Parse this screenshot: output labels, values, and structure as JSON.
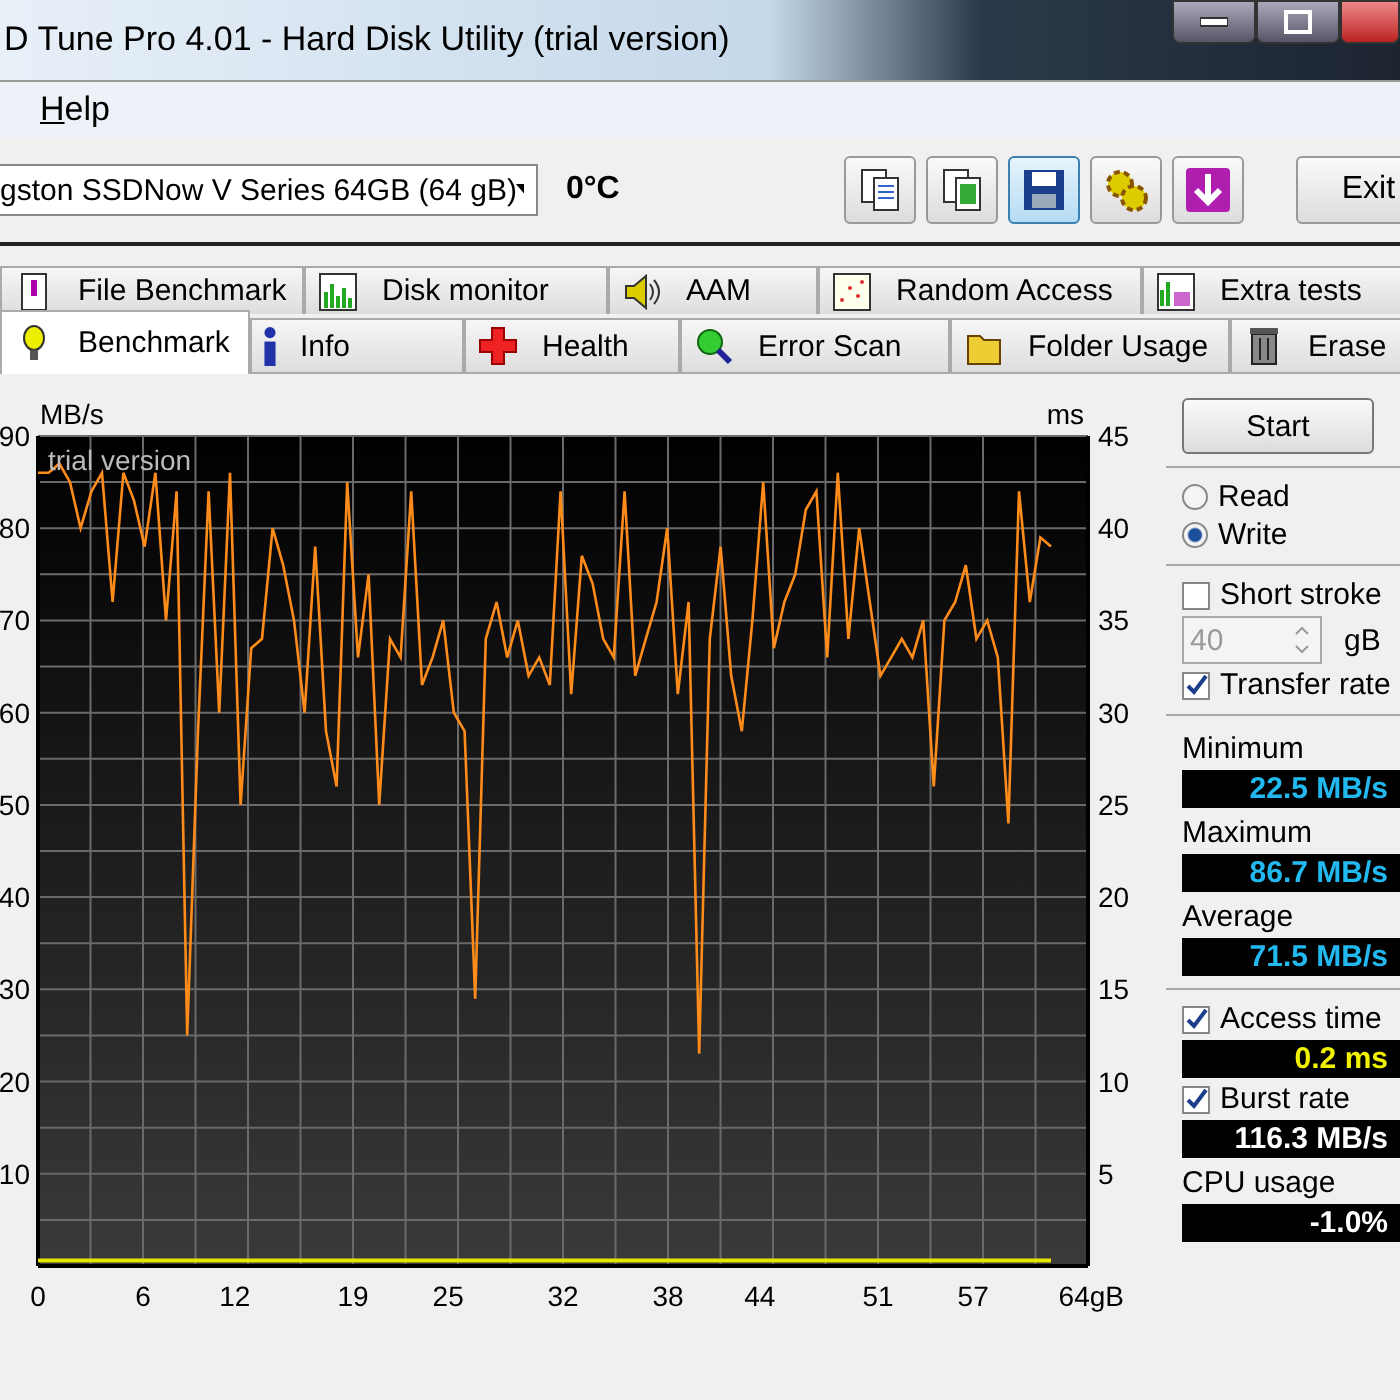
{
  "window": {
    "title": "D Tune Pro 4.01 - Hard Disk Utility (trial version)"
  },
  "menu": [
    {
      "label": "Help"
    }
  ],
  "toolbar": {
    "drive": "gston SSDNow V Series 64GB (64 gB)",
    "temperature": "0°C",
    "exit": "Exit"
  },
  "tabs_back": [
    {
      "label": "File Benchmark",
      "selected": false
    },
    {
      "label": "Disk monitor",
      "selected": false
    },
    {
      "label": "AAM",
      "selected": false
    },
    {
      "label": "Random Access",
      "selected": false
    },
    {
      "label": "Extra tests",
      "selected": false
    }
  ],
  "tabs_front": [
    {
      "label": "Benchmark",
      "selected": true
    },
    {
      "label": "Info",
      "selected": false
    },
    {
      "label": "Health",
      "selected": false
    },
    {
      "label": "Error Scan",
      "selected": false
    },
    {
      "label": "Folder Usage",
      "selected": false
    },
    {
      "label": "Erase",
      "selected": false
    }
  ],
  "chart": {
    "overlay_text": "trial version",
    "chart_data": {
      "type": "line",
      "grid": true,
      "ylabel": "MB/s",
      "y2label": "ms",
      "xlim": [
        0,
        64
      ],
      "ylim": [
        0,
        90
      ],
      "y2lim": [
        0,
        45
      ],
      "xticks": [
        {
          "value": 0,
          "label": "0"
        },
        {
          "value": 6.4,
          "label": "6"
        },
        {
          "value": 12,
          "label": "12"
        },
        {
          "value": 19.2,
          "label": "19"
        },
        {
          "value": 25,
          "label": "25"
        },
        {
          "value": 32,
          "label": "32"
        },
        {
          "value": 38.4,
          "label": "38"
        },
        {
          "value": 44,
          "label": "44"
        },
        {
          "value": 51.2,
          "label": "51"
        },
        {
          "value": 57,
          "label": "57"
        },
        {
          "value": 64,
          "label": "64gB"
        }
      ],
      "yticks": [
        10,
        20,
        30,
        40,
        50,
        60,
        70,
        80,
        90
      ],
      "y2ticks": [
        5,
        10,
        15,
        20,
        25,
        30,
        35,
        40,
        45
      ],
      "x": [
        0,
        0.65,
        1.3,
        1.95,
        2.6,
        3.25,
        3.9,
        4.55,
        5.2,
        5.85,
        6.5,
        7.15,
        7.8,
        8.45,
        9.1,
        9.75,
        10.4,
        11.05,
        11.7,
        12.35,
        13,
        13.65,
        14.3,
        14.95,
        15.6,
        16.25,
        16.9,
        17.55,
        18.2,
        18.85,
        19.5,
        20.15,
        20.8,
        21.45,
        22.1,
        22.75,
        23.4,
        24.05,
        24.7,
        25.35,
        26,
        26.65,
        27.3,
        27.95,
        28.6,
        29.25,
        29.9,
        30.55,
        31.2,
        31.85,
        32.5,
        33.15,
        33.8,
        34.45,
        35.1,
        35.75,
        36.4,
        37.05,
        37.7,
        38.35,
        39,
        39.65,
        40.3,
        40.95,
        41.6,
        42.25,
        42.9,
        43.55,
        44.2,
        44.85,
        45.5,
        46.15,
        46.8,
        47.45,
        48.1,
        48.75,
        49.4,
        50.05,
        50.7,
        51.35,
        52,
        52.65,
        53.3,
        53.95,
        54.6,
        55.25,
        55.9,
        56.55,
        57.2,
        57.85,
        58.5,
        59.15,
        59.8,
        60.45,
        61.1,
        61.75
      ],
      "series": [
        {
          "color": "#ff8c1a",
          "values": [
            86,
            86,
            87,
            85,
            80,
            84,
            86,
            72,
            86,
            83,
            78,
            86,
            70,
            84,
            25,
            58,
            84,
            60,
            86,
            50,
            67,
            68,
            80,
            76,
            70,
            60,
            78,
            58,
            52,
            85,
            66,
            75,
            50,
            68,
            66,
            84,
            63,
            66,
            70,
            60,
            58,
            29,
            68,
            72,
            66,
            70,
            64,
            66,
            63,
            84,
            62,
            77,
            74,
            68,
            66,
            84,
            64,
            68,
            72,
            80,
            62,
            72,
            23,
            68,
            78,
            64,
            58,
            70,
            85,
            67,
            72,
            75,
            82,
            84,
            66,
            86,
            68,
            80,
            72,
            64,
            66,
            68,
            66,
            70,
            52,
            70,
            72,
            76,
            68,
            70,
            66,
            48,
            84,
            72,
            79,
            78
          ]
        },
        {
          "color": "#e6e600",
          "axis": "y2",
          "values": [
            0.3,
            0.3,
            0.3,
            0.3,
            0.3,
            0.3,
            0.3,
            0.3,
            0.3,
            0.3,
            0.3,
            0.3,
            0.3,
            0.3,
            0.3,
            0.3,
            0.3,
            0.3,
            0.3,
            0.3,
            0.3,
            0.3,
            0.3,
            0.3,
            0.3,
            0.3,
            0.3,
            0.3,
            0.3,
            0.3,
            0.3,
            0.3,
            0.3,
            0.3,
            0.3,
            0.3,
            0.3,
            0.3,
            0.3,
            0.3,
            0.3,
            0.3,
            0.3,
            0.3,
            0.3,
            0.3,
            0.3,
            0.3,
            0.3,
            0.3,
            0.3,
            0.3,
            0.3,
            0.3,
            0.3,
            0.3,
            0.3,
            0.3,
            0.3,
            0.3,
            0.3,
            0.3,
            0.3,
            0.3,
            0.3,
            0.3,
            0.3,
            0.3,
            0.3,
            0.3,
            0.3,
            0.3,
            0.3,
            0.3,
            0.3,
            0.3,
            0.3,
            0.3,
            0.3,
            0.3,
            0.3,
            0.3,
            0.3,
            0.3,
            0.3,
            0.3,
            0.3,
            0.3,
            0.3,
            0.3,
            0.3,
            0.3,
            0.3,
            0.3,
            0.3,
            0.3
          ]
        }
      ]
    }
  },
  "panel": [
    [
      {
        "kind": "button",
        "label": "Start"
      }
    ],
    [
      {
        "kind": "radio",
        "label": "Read",
        "selected": false
      },
      {
        "kind": "radio",
        "label": "Write",
        "selected": true
      }
    ],
    [
      {
        "kind": "checkbox",
        "label": "Short stroke",
        "checked": false
      },
      {
        "kind": "spinner",
        "value": "40",
        "unit": "gB",
        "disabled": true
      },
      {
        "kind": "checkbox",
        "label": "Transfer rate",
        "checked": true
      }
    ],
    [
      {
        "kind": "label",
        "label": "Minimum"
      },
      {
        "kind": "rate_readout",
        "value": "22.5 MB/s"
      },
      {
        "kind": "label",
        "label": "Maximum"
      },
      {
        "kind": "rate_readout",
        "value": "86.7 MB/s"
      },
      {
        "kind": "label",
        "label": "Average"
      },
      {
        "kind": "rate_readout",
        "value": "71.5 MB/s"
      }
    ],
    [
      {
        "kind": "checkbox",
        "label": "Access time",
        "checked": true
      },
      {
        "kind": "time_readout",
        "value": "0.2 ms"
      },
      {
        "kind": "checkbox",
        "label": "Burst rate",
        "checked": true
      },
      {
        "kind": "readout",
        "value": "116.3 MB/s"
      },
      {
        "kind": "label",
        "label": "CPU usage"
      },
      {
        "kind": "readout",
        "value": "-1.0%"
      }
    ]
  ]
}
